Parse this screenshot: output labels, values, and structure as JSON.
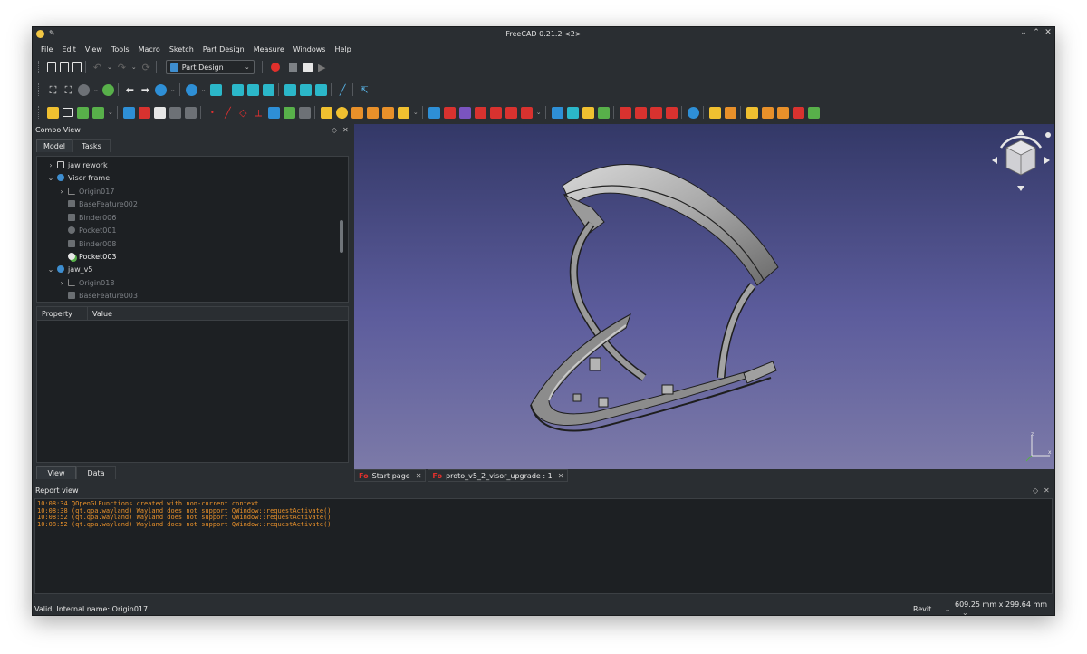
{
  "window": {
    "title": "FreeCAD 0.21.2 <2>"
  },
  "menubar": [
    "File",
    "Edit",
    "View",
    "Tools",
    "Macro",
    "Sketch",
    "Part Design",
    "Measure",
    "Windows",
    "Help"
  ],
  "toolbar": {
    "workbench": "Part Design"
  },
  "combo_view": {
    "title": "Combo View",
    "tabs": [
      "Model",
      "Tasks"
    ],
    "bottom_tabs": [
      "View",
      "Data"
    ],
    "tree": [
      {
        "label": "jaw rework",
        "icon": "folder-icon",
        "level": 1,
        "expander": ">",
        "state": "normal"
      },
      {
        "label": "Visor frame",
        "icon": "body-icon",
        "level": 1,
        "expander": "v",
        "state": "normal"
      },
      {
        "label": "Origin017",
        "icon": "origin-icon",
        "level": 2,
        "expander": ">",
        "state": "dim"
      },
      {
        "label": "BaseFeature002",
        "icon": "feature-icon",
        "level": 2,
        "expander": "",
        "state": "dim"
      },
      {
        "label": "Binder006",
        "icon": "binder-icon",
        "level": 2,
        "expander": "",
        "state": "dim"
      },
      {
        "label": "Pocket001",
        "icon": "pocket-icon",
        "level": 2,
        "expander": "",
        "state": "dim"
      },
      {
        "label": "Binder008",
        "icon": "binder-icon",
        "level": 2,
        "expander": "",
        "state": "dim"
      },
      {
        "label": "Pocket003",
        "icon": "pocket-tip-icon",
        "level": 2,
        "expander": "",
        "state": "bright"
      },
      {
        "label": "jaw_v5",
        "icon": "body-icon",
        "level": 1,
        "expander": "v",
        "state": "normal"
      },
      {
        "label": "Origin018",
        "icon": "origin-icon",
        "level": 2,
        "expander": ">",
        "state": "dim"
      },
      {
        "label": "BaseFeature003",
        "icon": "feature-icon",
        "level": 2,
        "expander": "",
        "state": "dim"
      }
    ],
    "property_columns": [
      "Property",
      "Value"
    ]
  },
  "document_tabs": [
    {
      "label": "Start page"
    },
    {
      "label": "proto_v5_2_visor_upgrade : 1"
    }
  ],
  "report_view": {
    "title": "Report view",
    "lines": [
      "10:08:34  QOpenGLFunctions created with non-current context",
      "10:08:38  (qt.qpa.wayland) Wayland does not support QWindow::requestActivate()",
      "10:08:52  (qt.qpa.wayland) Wayland does not support QWindow::requestActivate()",
      "10:08:52  (qt.qpa.wayland) Wayland does not support QWindow::requestActivate()"
    ]
  },
  "statusbar": {
    "message": "Valid, Internal name: Origin017",
    "navigation_style": "Revit",
    "dimensions": "609.25 mm x 299.64 mm"
  },
  "colors": {
    "background": "#2a2e32",
    "panel": "#1d2023",
    "accent": "#3daee9",
    "log_text": "#e8902a",
    "viewport_top": "#333867",
    "viewport_bottom": "#7c7aa8"
  }
}
